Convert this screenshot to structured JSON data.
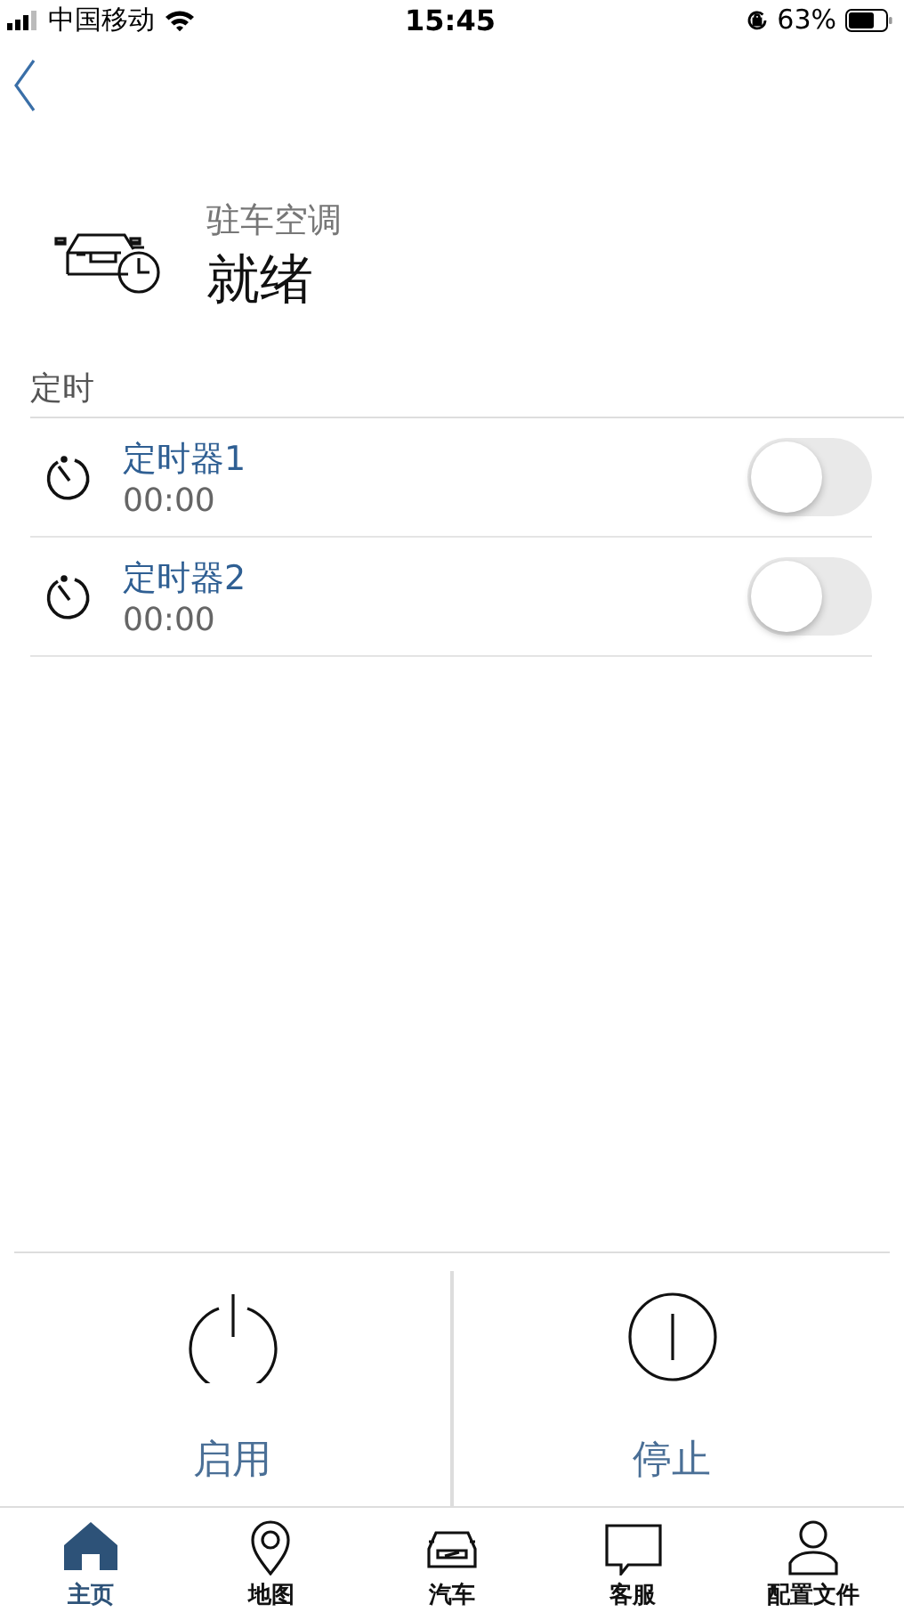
{
  "status_bar": {
    "carrier": "中国移动",
    "time": "15:45",
    "battery": "63%"
  },
  "header": {
    "subtitle": "驻车空调",
    "title": "就绪"
  },
  "section": {
    "label": "定时"
  },
  "timers": [
    {
      "name": "定时器1",
      "time": "00:00",
      "on": false
    },
    {
      "name": "定时器2",
      "time": "00:00",
      "on": false
    }
  ],
  "actions": [
    {
      "kind": "start",
      "label": "启用"
    },
    {
      "kind": "stop",
      "label": "停止"
    }
  ],
  "tabs": [
    {
      "kind": "home",
      "label": "主页",
      "selected": true
    },
    {
      "kind": "map",
      "label": "地图",
      "selected": false
    },
    {
      "kind": "car",
      "label": "汽车",
      "selected": false
    },
    {
      "kind": "chat",
      "label": "客服",
      "selected": false
    },
    {
      "kind": "profile",
      "label": "配置文件",
      "selected": false
    }
  ]
}
